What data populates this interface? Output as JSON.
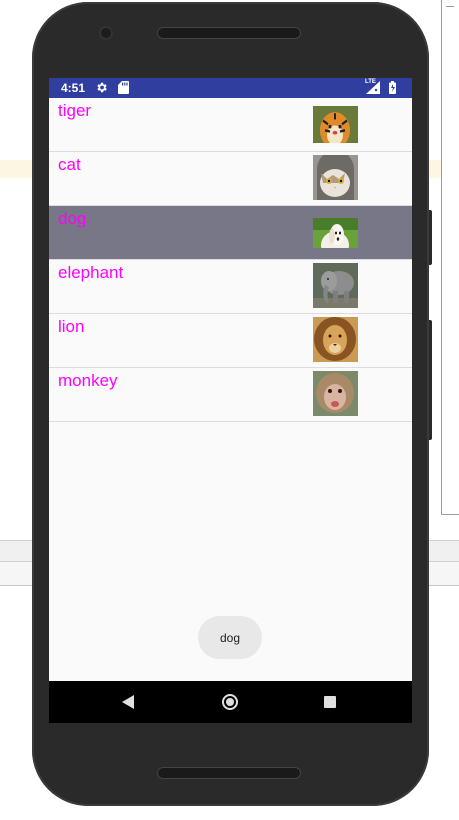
{
  "status_bar": {
    "time": "4:51",
    "network": "LTE",
    "icons": [
      "gear-icon",
      "sd-card-icon",
      "signal-icon",
      "battery-icon"
    ],
    "color": "#303f9f"
  },
  "list": {
    "items": [
      {
        "label": "tiger",
        "thumbnail": "tiger-photo",
        "selected": false
      },
      {
        "label": "cat",
        "thumbnail": "cat-photo",
        "selected": false
      },
      {
        "label": "dog",
        "thumbnail": "dog-photo",
        "selected": true
      },
      {
        "label": "elephant",
        "thumbnail": "elephant-photo",
        "selected": false
      },
      {
        "label": "lion",
        "thumbnail": "lion-photo",
        "selected": false
      },
      {
        "label": "monkey",
        "thumbnail": "monkey-photo",
        "selected": false
      }
    ],
    "label_color": "#ff00ff",
    "selected_row_color": "#777788"
  },
  "toast": {
    "text": "dog"
  },
  "nav_bar": {
    "icons": [
      "back-icon",
      "home-icon",
      "recents-icon"
    ]
  }
}
